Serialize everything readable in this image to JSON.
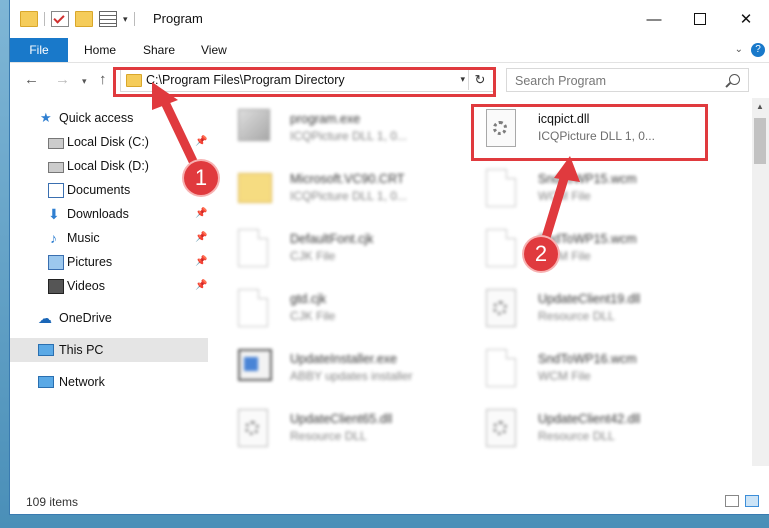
{
  "window": {
    "title": "Program"
  },
  "ribbon": {
    "tabs": [
      {
        "label": "File"
      },
      {
        "label": "Home"
      },
      {
        "label": "Share"
      },
      {
        "label": "View"
      }
    ],
    "help": "?"
  },
  "nav": {
    "address": "C:\\Program Files\\Program Directory",
    "search_placeholder": "Search Program"
  },
  "sidebar": {
    "items": [
      {
        "label": "Quick access",
        "icon": "star-icon"
      },
      {
        "label": "Local Disk (C:)",
        "icon": "drive-icon",
        "pinned": true
      },
      {
        "label": "Local Disk (D:)",
        "icon": "drive-icon",
        "pinned": false
      },
      {
        "label": "Documents",
        "icon": "documents-icon",
        "pinned": true
      },
      {
        "label": "Downloads",
        "icon": "download-icon",
        "pinned": true
      },
      {
        "label": "Music",
        "icon": "music-icon",
        "pinned": true
      },
      {
        "label": "Pictures",
        "icon": "pictures-icon",
        "pinned": true
      },
      {
        "label": "Videos",
        "icon": "videos-icon",
        "pinned": true
      },
      {
        "label": "OneDrive",
        "icon": "cloud-icon"
      },
      {
        "label": "This PC",
        "icon": "computer-icon",
        "selected": true
      },
      {
        "label": "Network",
        "icon": "network-icon"
      }
    ]
  },
  "files": [
    {
      "name": "program.exe",
      "desc": "ICQPicture DLL 1, 0...",
      "icon": "exe-icon"
    },
    {
      "name": "icqpict.dll",
      "desc": "ICQPicture DLL 1, 0...",
      "icon": "dll-gear-icon"
    },
    {
      "name": "Microsoft.VC90.CRT",
      "desc": "ICQPicture DLL 1, 0...",
      "icon": "folder-icon"
    },
    {
      "name": "SndToWP15.wcm",
      "desc": "WCM File",
      "icon": "file-icon"
    },
    {
      "name": "DefaultFont.cjk",
      "desc": "CJK File",
      "icon": "file-icon"
    },
    {
      "name": "SndToWP15.wcm",
      "desc": "WCM File",
      "icon": "file-icon"
    },
    {
      "name": "gtd.cjk",
      "desc": "CJK File",
      "icon": "file-icon"
    },
    {
      "name": "UpdateClient19.dll",
      "desc": "Resource DLL",
      "icon": "dll-gear-icon"
    },
    {
      "name": "UpdateInstaller.exe",
      "desc": "ABBY updates installer",
      "icon": "installer-icon"
    },
    {
      "name": "SndToWP16.wcm",
      "desc": "WCM File",
      "icon": "file-icon"
    },
    {
      "name": "UpdateClient65.dll",
      "desc": "Resource DLL",
      "icon": "dll-gear-icon"
    },
    {
      "name": "UpdateClient42.dll",
      "desc": "Resource DLL",
      "icon": "dll-gear-icon"
    }
  ],
  "status": {
    "item_count": "109 items"
  },
  "steps": {
    "one": "1",
    "two": "2"
  },
  "colors": {
    "accent": "#1979ca",
    "highlight": "#e03a3e"
  }
}
